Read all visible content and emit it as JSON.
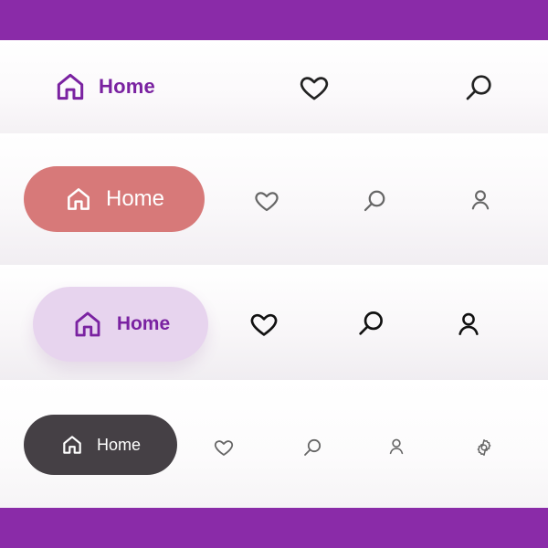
{
  "theme": {
    "brand_purple": "#8A2BA8",
    "home_purple": "#7A22A1",
    "coral_pill": "#D77979",
    "lilac_pill": "#E7D4EE",
    "dark_pill": "#454045",
    "icon_gray": "#666666",
    "icon_dark": "#111111"
  },
  "nav_bars": [
    {
      "name": "nav-bar-1",
      "active_label": "Home",
      "icons": [
        "home-icon",
        "heart-icon",
        "search-icon"
      ]
    },
    {
      "name": "nav-bar-2",
      "active_label": "Home",
      "icons": [
        "home-icon",
        "heart-icon",
        "search-icon",
        "user-icon"
      ]
    },
    {
      "name": "nav-bar-3",
      "active_label": "Home",
      "icons": [
        "home-icon",
        "heart-icon",
        "search-icon",
        "user-icon"
      ]
    },
    {
      "name": "nav-bar-4",
      "active_label": "Home",
      "icons": [
        "home-icon",
        "heart-icon",
        "search-icon",
        "user-icon",
        "gear-icon"
      ]
    }
  ]
}
